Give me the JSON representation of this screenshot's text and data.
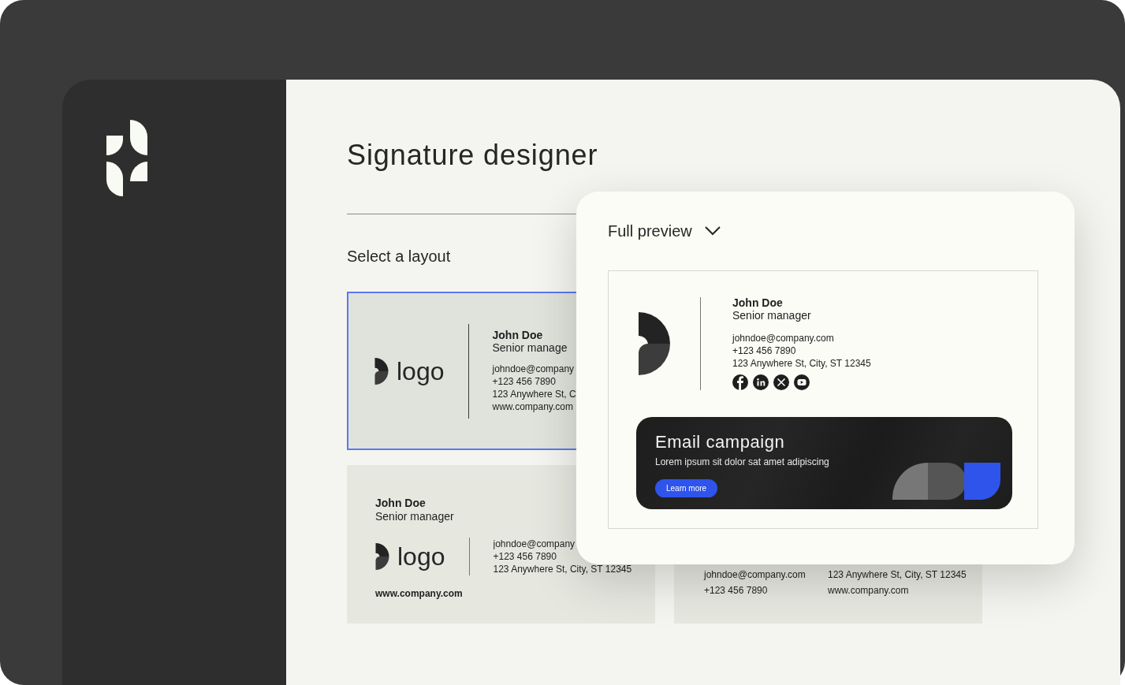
{
  "app": {
    "title": "Signature designer"
  },
  "layout_section": {
    "heading": "Select a layout",
    "layouts": [
      {
        "kind": "logo_left",
        "selected": true,
        "logo_text": "logo",
        "name": "John Doe",
        "role": "Senior manage",
        "email": "johndoe@company",
        "phone": "+123 456 7890",
        "address": "123 Anywhere St, C",
        "website": "www.company.com"
      },
      {
        "kind": "name_top",
        "selected": false,
        "logo_text": "logo",
        "name": "John Doe",
        "role": "Senior manager",
        "email": "johndoe@company",
        "phone": "+123 456 7890",
        "address": "123 Anywhere St, City, ST 12345",
        "website": "www.company.com"
      },
      {
        "kind": "contacts_grid",
        "selected": false,
        "email": "johndoe@company.com",
        "phone": "+123 456 7890",
        "address": "123 Anywhere St, City, ST 12345",
        "website": "www.company.com"
      }
    ]
  },
  "preview": {
    "mode": "Full preview",
    "signature": {
      "name": "John Doe",
      "role": "Senior manager",
      "email": "johndoe@company.com",
      "phone": "+123 456 7890",
      "address": "123 Anywhere St, City, ST 12345"
    },
    "banner": {
      "title": "Email campaign",
      "text": "Lorem ipsum sit dolor sat amet adipiscing",
      "button": "Learn more"
    }
  }
}
